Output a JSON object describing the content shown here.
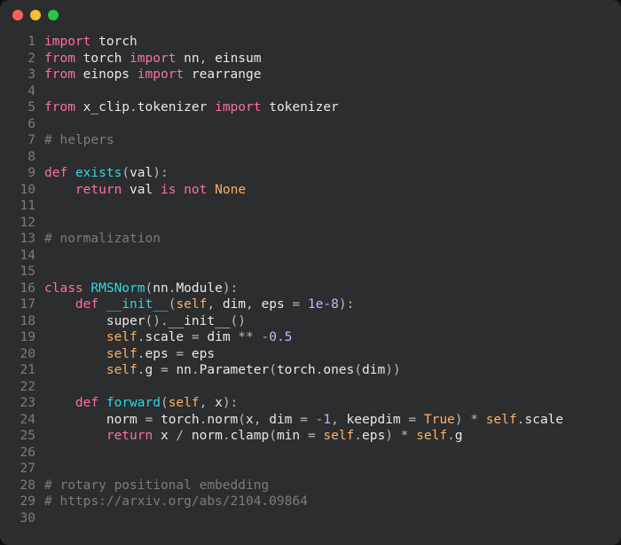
{
  "titlebar": {
    "buttons": [
      "close",
      "minimize",
      "zoom"
    ]
  },
  "chart_data": null,
  "code": {
    "language": "python",
    "lines": [
      {
        "n": 1,
        "tokens": [
          [
            "kw",
            "import"
          ],
          [
            "pun",
            " "
          ],
          [
            "id",
            "torch"
          ]
        ]
      },
      {
        "n": 2,
        "tokens": [
          [
            "kw",
            "from"
          ],
          [
            "pun",
            " "
          ],
          [
            "id",
            "torch"
          ],
          [
            "pun",
            " "
          ],
          [
            "kw",
            "import"
          ],
          [
            "pun",
            " "
          ],
          [
            "id",
            "nn"
          ],
          [
            "pun",
            ", "
          ],
          [
            "id",
            "einsum"
          ]
        ]
      },
      {
        "n": 3,
        "tokens": [
          [
            "kw",
            "from"
          ],
          [
            "pun",
            " "
          ],
          [
            "id",
            "einops"
          ],
          [
            "pun",
            " "
          ],
          [
            "kw",
            "import"
          ],
          [
            "pun",
            " "
          ],
          [
            "id",
            "rearrange"
          ]
        ]
      },
      {
        "n": 4,
        "tokens": []
      },
      {
        "n": 5,
        "tokens": [
          [
            "kw",
            "from"
          ],
          [
            "pun",
            " "
          ],
          [
            "id",
            "x_clip"
          ],
          [
            "pun",
            "."
          ],
          [
            "id",
            "tokenizer"
          ],
          [
            "pun",
            " "
          ],
          [
            "kw",
            "import"
          ],
          [
            "pun",
            " "
          ],
          [
            "id",
            "tokenizer"
          ]
        ]
      },
      {
        "n": 6,
        "tokens": []
      },
      {
        "n": 7,
        "tokens": [
          [
            "cmt",
            "# helpers"
          ]
        ]
      },
      {
        "n": 8,
        "tokens": []
      },
      {
        "n": 9,
        "tokens": [
          [
            "kw",
            "def"
          ],
          [
            "pun",
            " "
          ],
          [
            "fn",
            "exists"
          ],
          [
            "pun",
            "("
          ],
          [
            "id",
            "val"
          ],
          [
            "pun",
            "):"
          ]
        ]
      },
      {
        "n": 10,
        "tokens": [
          [
            "pun",
            "    "
          ],
          [
            "kw",
            "return"
          ],
          [
            "pun",
            " "
          ],
          [
            "id",
            "val"
          ],
          [
            "pun",
            " "
          ],
          [
            "kw",
            "is"
          ],
          [
            "pun",
            " "
          ],
          [
            "kw",
            "not"
          ],
          [
            "pun",
            " "
          ],
          [
            "bool",
            "None"
          ]
        ]
      },
      {
        "n": 11,
        "tokens": []
      },
      {
        "n": 12,
        "tokens": []
      },
      {
        "n": 13,
        "tokens": [
          [
            "cmt",
            "# normalization"
          ]
        ]
      },
      {
        "n": 14,
        "tokens": []
      },
      {
        "n": 15,
        "tokens": []
      },
      {
        "n": 16,
        "tokens": [
          [
            "kw",
            "class"
          ],
          [
            "pun",
            " "
          ],
          [
            "fn",
            "RMSNorm"
          ],
          [
            "pun",
            "("
          ],
          [
            "id",
            "nn"
          ],
          [
            "pun",
            "."
          ],
          [
            "id",
            "Module"
          ],
          [
            "pun",
            "):"
          ]
        ]
      },
      {
        "n": 17,
        "tokens": [
          [
            "pun",
            "    "
          ],
          [
            "kw",
            "def"
          ],
          [
            "pun",
            " "
          ],
          [
            "fn",
            "__init__"
          ],
          [
            "pun",
            "("
          ],
          [
            "arg",
            "self"
          ],
          [
            "pun",
            ", "
          ],
          [
            "id",
            "dim"
          ],
          [
            "pun",
            ", "
          ],
          [
            "id",
            "eps"
          ],
          [
            "pun",
            " = "
          ],
          [
            "num",
            "1e-8"
          ],
          [
            "pun",
            "):"
          ]
        ]
      },
      {
        "n": 18,
        "tokens": [
          [
            "pun",
            "        "
          ],
          [
            "id",
            "super"
          ],
          [
            "pun",
            "()."
          ],
          [
            "id",
            "__init__"
          ],
          [
            "pun",
            "()"
          ]
        ]
      },
      {
        "n": 19,
        "tokens": [
          [
            "pun",
            "        "
          ],
          [
            "arg",
            "self"
          ],
          [
            "pun",
            "."
          ],
          [
            "id",
            "scale"
          ],
          [
            "pun",
            " = "
          ],
          [
            "id",
            "dim"
          ],
          [
            "pun",
            " ** -"
          ],
          [
            "num",
            "0.5"
          ]
        ]
      },
      {
        "n": 20,
        "tokens": [
          [
            "pun",
            "        "
          ],
          [
            "arg",
            "self"
          ],
          [
            "pun",
            "."
          ],
          [
            "id",
            "eps"
          ],
          [
            "pun",
            " = "
          ],
          [
            "id",
            "eps"
          ]
        ]
      },
      {
        "n": 21,
        "tokens": [
          [
            "pun",
            "        "
          ],
          [
            "arg",
            "self"
          ],
          [
            "pun",
            "."
          ],
          [
            "id",
            "g"
          ],
          [
            "pun",
            " = "
          ],
          [
            "id",
            "nn"
          ],
          [
            "pun",
            "."
          ],
          [
            "id",
            "Parameter"
          ],
          [
            "pun",
            "("
          ],
          [
            "id",
            "torch"
          ],
          [
            "pun",
            "."
          ],
          [
            "id",
            "ones"
          ],
          [
            "pun",
            "("
          ],
          [
            "id",
            "dim"
          ],
          [
            "pun",
            "))"
          ]
        ]
      },
      {
        "n": 22,
        "tokens": []
      },
      {
        "n": 23,
        "tokens": [
          [
            "pun",
            "    "
          ],
          [
            "kw",
            "def"
          ],
          [
            "pun",
            " "
          ],
          [
            "fn",
            "forward"
          ],
          [
            "pun",
            "("
          ],
          [
            "arg",
            "self"
          ],
          [
            "pun",
            ", "
          ],
          [
            "id",
            "x"
          ],
          [
            "pun",
            "):"
          ]
        ]
      },
      {
        "n": 24,
        "tokens": [
          [
            "pun",
            "        "
          ],
          [
            "id",
            "norm"
          ],
          [
            "pun",
            " = "
          ],
          [
            "id",
            "torch"
          ],
          [
            "pun",
            "."
          ],
          [
            "id",
            "norm"
          ],
          [
            "pun",
            "("
          ],
          [
            "id",
            "x"
          ],
          [
            "pun",
            ", "
          ],
          [
            "id",
            "dim"
          ],
          [
            "pun",
            " = -"
          ],
          [
            "num",
            "1"
          ],
          [
            "pun",
            ", "
          ],
          [
            "id",
            "keepdim"
          ],
          [
            "pun",
            " = "
          ],
          [
            "bool",
            "True"
          ],
          [
            "pun",
            ") * "
          ],
          [
            "arg",
            "self"
          ],
          [
            "pun",
            "."
          ],
          [
            "id",
            "scale"
          ]
        ]
      },
      {
        "n": 25,
        "tokens": [
          [
            "pun",
            "        "
          ],
          [
            "kw",
            "return"
          ],
          [
            "pun",
            " "
          ],
          [
            "id",
            "x"
          ],
          [
            "pun",
            " / "
          ],
          [
            "id",
            "norm"
          ],
          [
            "pun",
            "."
          ],
          [
            "id",
            "clamp"
          ],
          [
            "pun",
            "("
          ],
          [
            "id",
            "min"
          ],
          [
            "pun",
            " = "
          ],
          [
            "arg",
            "self"
          ],
          [
            "pun",
            "."
          ],
          [
            "id",
            "eps"
          ],
          [
            "pun",
            ") * "
          ],
          [
            "arg",
            "self"
          ],
          [
            "pun",
            "."
          ],
          [
            "id",
            "g"
          ]
        ]
      },
      {
        "n": 26,
        "tokens": []
      },
      {
        "n": 27,
        "tokens": []
      },
      {
        "n": 28,
        "tokens": [
          [
            "cmt",
            "# rotary positional embedding"
          ]
        ]
      },
      {
        "n": 29,
        "tokens": [
          [
            "cmt",
            "# https://arxiv.org/abs/2104.09864"
          ]
        ]
      },
      {
        "n": 30,
        "tokens": []
      }
    ]
  }
}
